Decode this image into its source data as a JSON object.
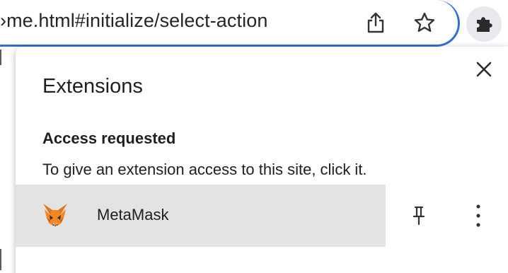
{
  "toolbar": {
    "url_text": "›me.html#initialize/select-action",
    "share_icon": "share-icon",
    "bookmark_icon": "star-icon",
    "extensions_icon": "puzzle-icon",
    "accent_color": "#2f6fd6"
  },
  "popup": {
    "title": "Extensions",
    "close_icon": "close-icon",
    "section_heading": "Access requested",
    "section_desc": "To give an extension access to this site, click it.",
    "extensions": [
      {
        "name": "MetaMask",
        "icon": "metamask-fox-icon",
        "pin_icon": "pin-icon",
        "more_icon": "more-vertical-icon"
      }
    ],
    "next_section_heading": ""
  }
}
